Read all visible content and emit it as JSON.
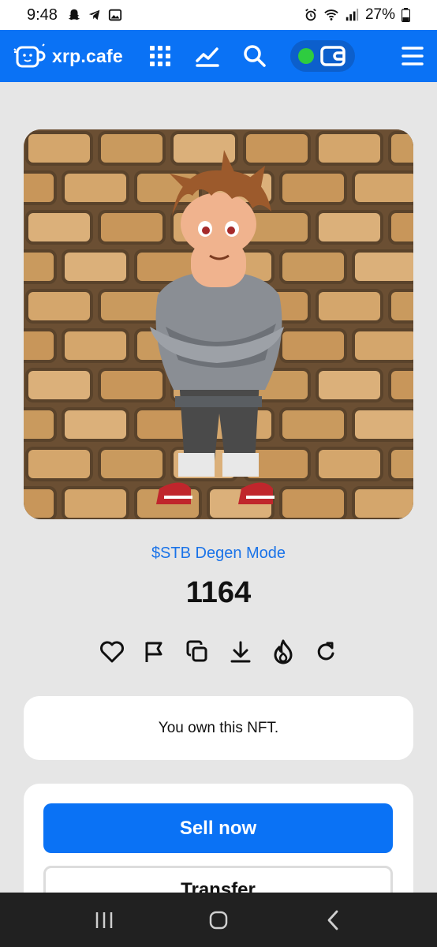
{
  "status_bar": {
    "time": "9:48",
    "battery": "27%",
    "left_icons": [
      "snapchat-icon",
      "telegram-icon",
      "gallery-icon"
    ],
    "right_icons": [
      "alarm-icon",
      "wifi-icon",
      "signal-icon",
      "battery-icon"
    ]
  },
  "nav": {
    "logo_text": "xrp.cafe",
    "icons": [
      "grid-icon",
      "chart-icon",
      "search-icon"
    ],
    "wallet_status_color": "#2ecc40",
    "accent": "#0a72f5"
  },
  "nft": {
    "image_alt": "Cartoon character in grey hoodie in front of brick wall",
    "collection": "$STB Degen Mode",
    "title": "1164",
    "actions": [
      "heart-icon",
      "flag-icon",
      "copy-icon",
      "download-icon",
      "fire-icon",
      "refresh-icon"
    ]
  },
  "ownership": {
    "message": "You own this NFT."
  },
  "trade": {
    "sell_label": "Sell now",
    "transfer_label": "Transfer"
  },
  "system_nav": [
    "recents-button",
    "home-button",
    "back-button"
  ]
}
